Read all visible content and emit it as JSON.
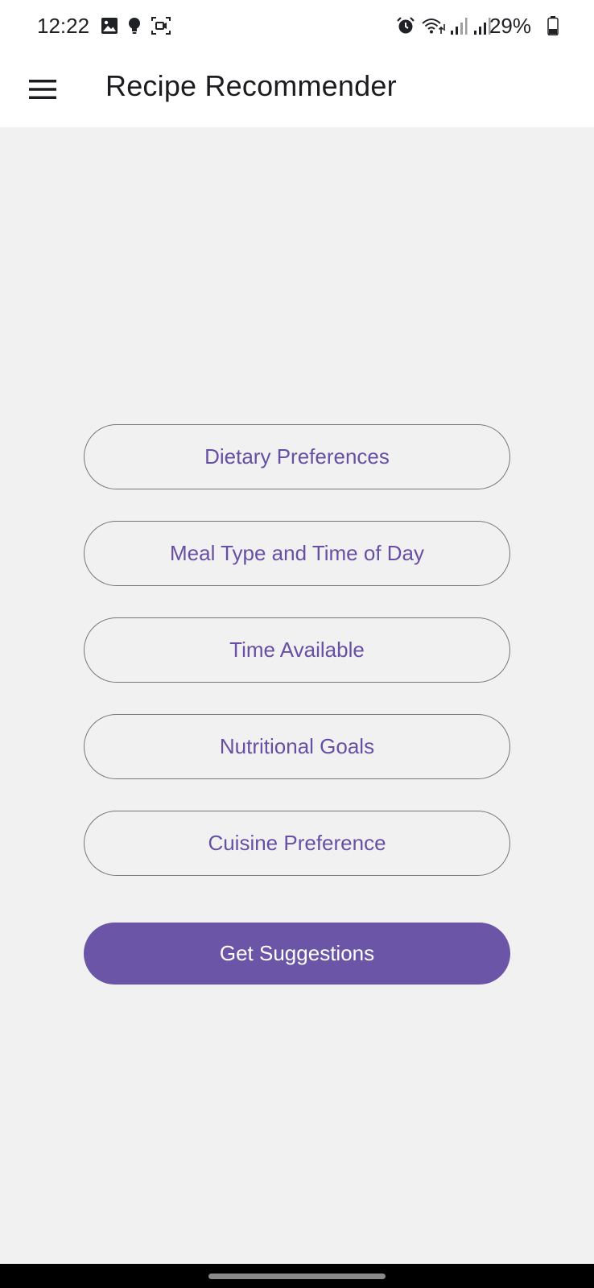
{
  "status_bar": {
    "time": "12:22",
    "battery": "29%",
    "icons": [
      "gallery-icon",
      "bulb-icon",
      "screen-record-icon",
      "alarm-icon",
      "wifi-icon",
      "signal-icon",
      "signal-icon",
      "battery-icon"
    ]
  },
  "app_bar": {
    "title": "Recipe Recommender",
    "menu_icon": "menu-icon"
  },
  "options": [
    {
      "label": "Dietary Preferences"
    },
    {
      "label": "Meal Type and Time of Day"
    },
    {
      "label": "Time Available"
    },
    {
      "label": "Nutritional Goals"
    },
    {
      "label": "Cuisine Preference"
    }
  ],
  "actions": {
    "get_suggestions": "Get Suggestions"
  },
  "colors": {
    "accent": "#6750a4",
    "primary_button": "#6b55a6",
    "background": "#f1f1f2",
    "outline": "#79757f"
  }
}
